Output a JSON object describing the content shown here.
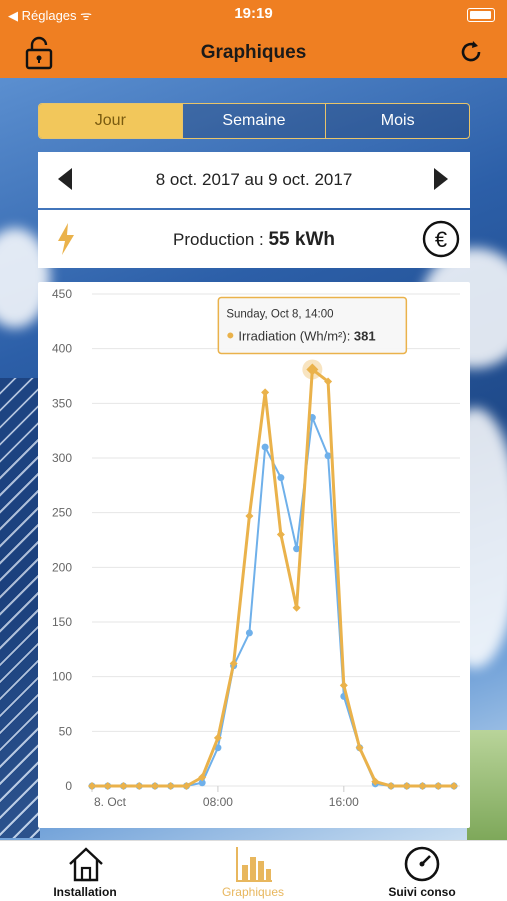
{
  "status": {
    "back": "Réglages",
    "time": "19:19"
  },
  "nav": {
    "title": "Graphiques"
  },
  "segments": [
    "Jour",
    "Semaine",
    "Mois"
  ],
  "date_range": "8 oct. 2017 au 9 oct. 2017",
  "production": {
    "label": "Production :",
    "value": "55 kWh"
  },
  "tooltip": {
    "date": "Sunday, Oct 8, 14:00",
    "series": "Irradiation (Wh/m²):",
    "value": "381"
  },
  "tabs": [
    "Installation",
    "Graphiques",
    "Suivi conso"
  ],
  "colors": {
    "accent": "#ef7f22",
    "irradiation": "#eab24b",
    "production": "#6fb0ea"
  },
  "chart_data": {
    "type": "line",
    "ylim": [
      0,
      450
    ],
    "yticks": [
      0,
      50,
      100,
      150,
      200,
      250,
      300,
      350,
      400,
      450
    ],
    "xtick_labels": [
      {
        "hour": 0,
        "label": "8. Oct"
      },
      {
        "hour": 8,
        "label": "08:00"
      },
      {
        "hour": 16,
        "label": "16:00"
      }
    ],
    "hours": [
      0,
      1,
      2,
      3,
      4,
      5,
      6,
      7,
      8,
      9,
      10,
      11,
      12,
      13,
      14,
      15,
      16,
      17,
      18,
      19,
      20,
      21,
      22,
      23
    ],
    "series": [
      {
        "name": "",
        "color": "#6fb0ea",
        "values": [
          0,
          0,
          0,
          0,
          0,
          0,
          0,
          3,
          35,
          110,
          140,
          310,
          282,
          217,
          337,
          302,
          82,
          35,
          2,
          0,
          0,
          0,
          0,
          0
        ]
      },
      {
        "name": "Irradiation (Wh/m²)",
        "color": "#eab24b",
        "values": [
          0,
          0,
          0,
          0,
          0,
          0,
          0,
          8,
          44,
          112,
          247,
          360,
          230,
          163,
          381,
          370,
          92,
          35,
          4,
          0,
          0,
          0,
          0,
          0
        ]
      }
    ],
    "highlight": {
      "series": 1,
      "hour": 14
    }
  }
}
